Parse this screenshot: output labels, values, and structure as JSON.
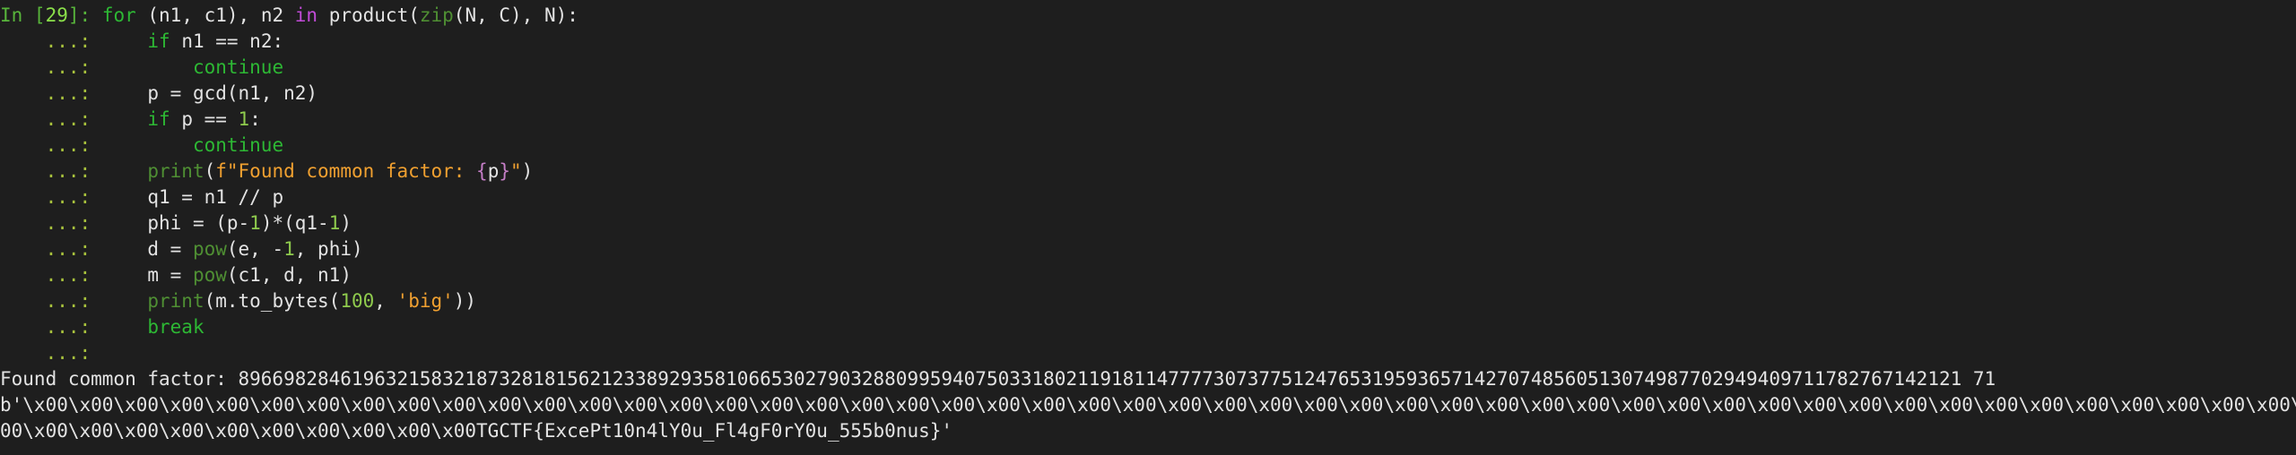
{
  "prompt": {
    "in_label": "In [",
    "in_number": "29",
    "in_suffix": "]: ",
    "continuation": "    ...: "
  },
  "code": {
    "l1": {
      "kw_for": "for",
      "a": " (n1, c1), n2 ",
      "kw_in": "in",
      "b": " product(",
      "fn_zip": "zip",
      "c": "(N, C), N):"
    },
    "l2": {
      "indent": "    ",
      "kw_if": "if",
      "rest": " n1 == n2:"
    },
    "l3": {
      "indent": "        ",
      "kw_continue": "continue"
    },
    "l4": {
      "indent": "    ",
      "text": "p = gcd(n1, n2)"
    },
    "l5": {
      "indent": "    ",
      "kw_if": "if",
      "a": " p == ",
      "num": "1",
      "b": ":"
    },
    "l6": {
      "indent": "        ",
      "kw_continue": "continue"
    },
    "l7": {
      "indent": "    ",
      "fn_print": "print",
      "open": "(",
      "fstr": "f\"Found common factor: ",
      "brace_open": "{",
      "var": "p",
      "brace_close": "}",
      "quote": "\"",
      "close": ")"
    },
    "l8": {
      "indent": "    ",
      "text": "q1 = n1 // p"
    },
    "l9": {
      "indent": "    ",
      "a": "phi = (p-",
      "num1": "1",
      "b": ")*(q1-",
      "num2": "1",
      "c": ")"
    },
    "l10": {
      "indent": "    ",
      "a": "d = ",
      "fn_pow": "pow",
      "b": "(e, -",
      "num": "1",
      "c": ", phi)"
    },
    "l11": {
      "indent": "    ",
      "a": "m = ",
      "fn_pow": "pow",
      "b": "(c1, d, n1)"
    },
    "l12": {
      "indent": "    ",
      "fn_print": "print",
      "a": "(m.to_bytes(",
      "num": "100",
      "b": ", ",
      "str": "'big'",
      "c": "))"
    },
    "l13": {
      "indent": "    ",
      "kw_break": "break"
    },
    "l14": {
      "indent": ""
    }
  },
  "output": {
    "line1": "Found common factor: 89669828461963215832187328181562123389293581066530279032880995940750331802119181147777307377512476531959365714270748560513074987702949409711782767142121 71",
    "line2": "b'\\x00\\x00\\x00\\x00\\x00\\x00\\x00\\x00\\x00\\x00\\x00\\x00\\x00\\x00\\x00\\x00\\x00\\x00\\x00\\x00\\x00\\x00\\x00\\x00\\x00\\x00\\x00\\x00\\x00\\x00\\x00\\x00\\x00\\x00\\x00\\x00\\x00\\x00\\x00\\x00\\x00\\x00\\x00\\x00\\x00\\x00\\x00\\x00\\x00\\x00\\x00\\x00\\x00\\x00\\x00\\x00\\x00\\x00\\x00\\x00\\x00\\x00\\x00\\x00\\x00\\x00\\x00\\x00\\x00\\x00\\x00\\x00\\x00\\x00\\x00\\x00\\x00\\x00\\x00\\x00\\x00\\x00\\x00\\x00\\x00\\x00\\x00\\x00\\x00\\x00\\x00\\x00\\x00\\x00\\x00\\x00\\x00\\x00\\x00\\x00\\x00\\x00\\x00\\x00\\x00\\x00\\x00\\x00\\x00\\x00\\x00\\x00\\x00\\x00\\x00\\x00\\x00\\x00\\x00\\x00\\x00\\x00",
    "line3": "00\\x00\\x00\\x00\\x00\\x00\\x00\\x00\\x00\\x00\\x00TGCTF{ExcePt10n4lY0u_Fl4gF0rY0u_555b0nus}'"
  },
  "colors": {
    "background": "#1e1e1e",
    "prompt_green": "#58b53b",
    "keyword_green": "#2db834",
    "keyword_purple": "#c24bd8",
    "builtin_green": "#4f8f33",
    "number_green": "#8fcb4d",
    "string_orange": "#f0a030",
    "interpolation_pink": "#c57ec7",
    "text": "#e3e3e3"
  }
}
